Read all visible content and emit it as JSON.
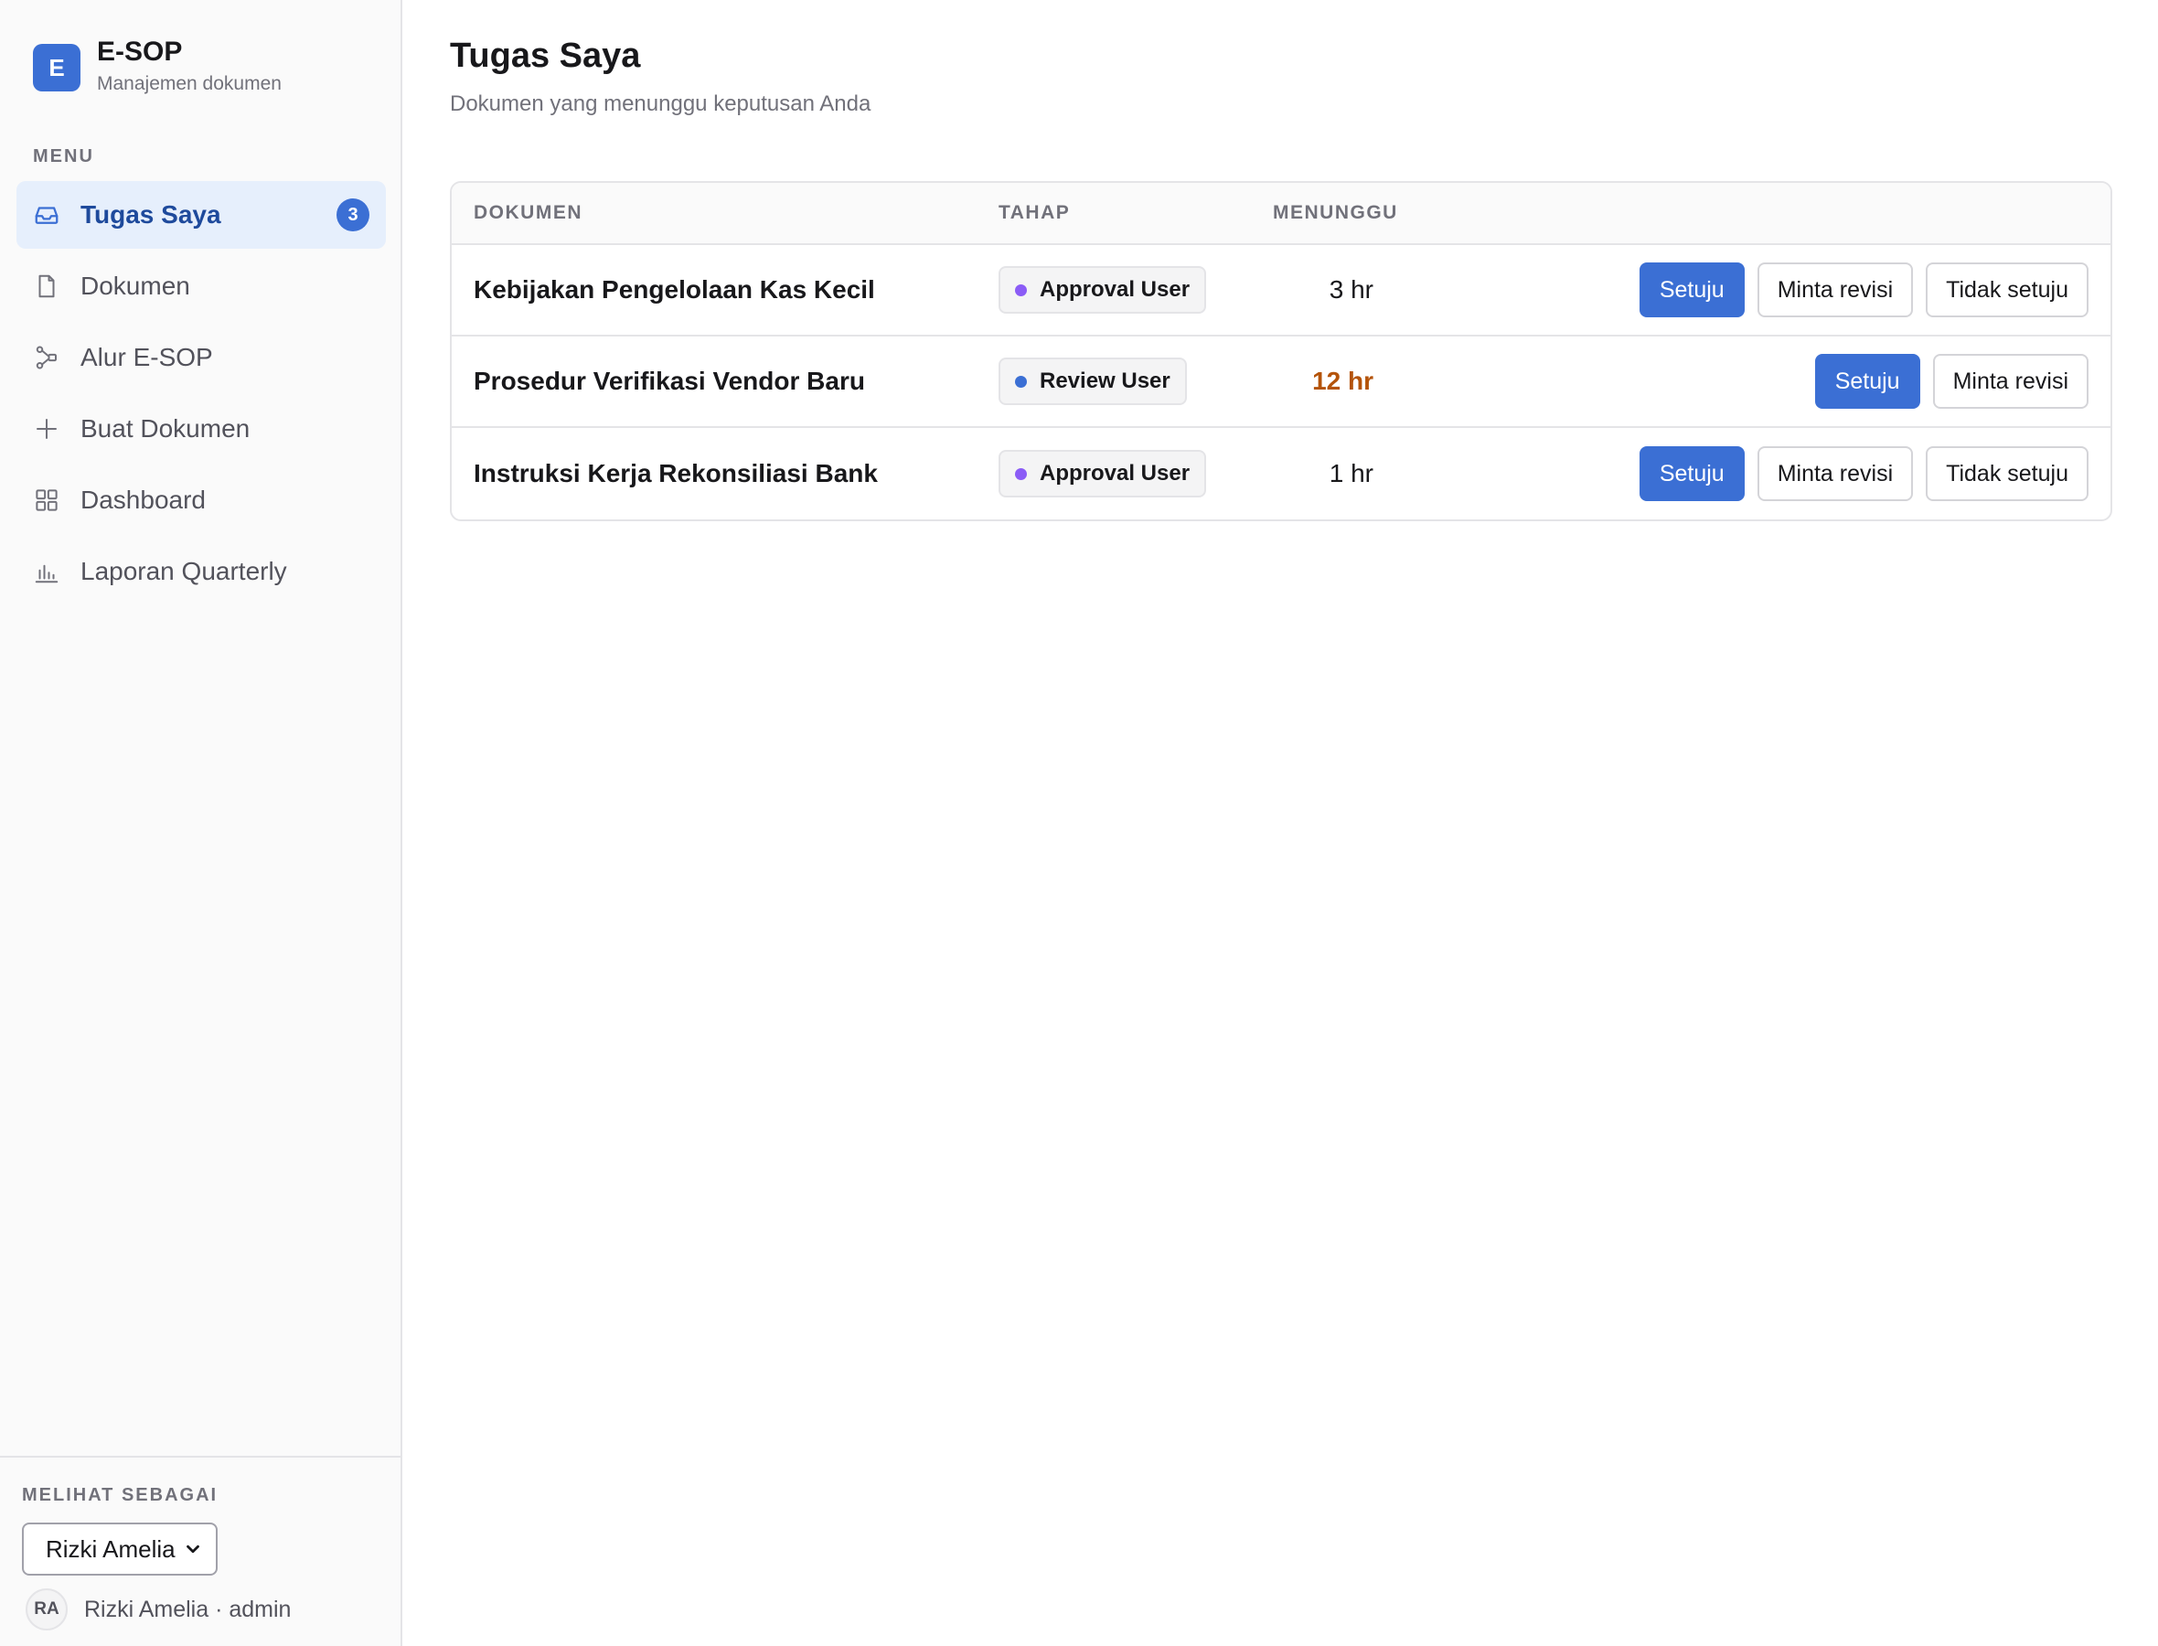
{
  "brand": {
    "logo_letter": "E",
    "name": "E-SOP",
    "subtitle": "Manajemen dokumen"
  },
  "sidebar": {
    "menu_label": "MENU",
    "items": [
      {
        "label": "Tugas Saya",
        "icon": "inbox-icon",
        "active": true,
        "badge": "3"
      },
      {
        "label": "Dokumen",
        "icon": "file-icon",
        "active": false
      },
      {
        "label": "Alur E-SOP",
        "icon": "workflow-icon",
        "active": false
      },
      {
        "label": "Buat Dokumen",
        "icon": "plus-icon",
        "active": false
      },
      {
        "label": "Dashboard",
        "icon": "grid-icon",
        "active": false
      },
      {
        "label": "Laporan Quarterly",
        "icon": "bar-chart-icon",
        "active": false
      }
    ],
    "view_as_label": "MELIHAT SEBAGAI",
    "selected_user": "Rizki Amelia",
    "avatar_initials": "RA",
    "user_info": "Rizki Amelia · admin"
  },
  "main": {
    "title": "Tugas Saya",
    "subtitle": "Dokumen yang menunggu keputusan Anda",
    "columns": [
      "DOKUMEN",
      "TAHAP",
      "MENUNGGU"
    ],
    "rows": [
      {
        "document": "Kebijakan Pengelolaan Kas Kecil",
        "stage": "Approval User",
        "stage_color": "#8b5cf6",
        "waiting": "3 hr",
        "late": false,
        "actions": [
          "Setuju",
          "Minta revisi",
          "Tidak setuju"
        ]
      },
      {
        "document": "Prosedur Verifikasi Vendor Baru",
        "stage": "Review User",
        "stage_color": "#3b6fd4",
        "waiting": "12 hr",
        "late": true,
        "actions": [
          "Setuju",
          "Minta revisi"
        ]
      },
      {
        "document": "Instruksi Kerja Rekonsiliasi Bank",
        "stage": "Approval User",
        "stage_color": "#8b5cf6",
        "waiting": "1 hr",
        "late": false,
        "actions": [
          "Setuju",
          "Minta revisi",
          "Tidak setuju"
        ]
      }
    ]
  },
  "colors": {
    "accent": "#3b6fd4",
    "late": "#b45309",
    "active_bg": "#e6effc"
  }
}
